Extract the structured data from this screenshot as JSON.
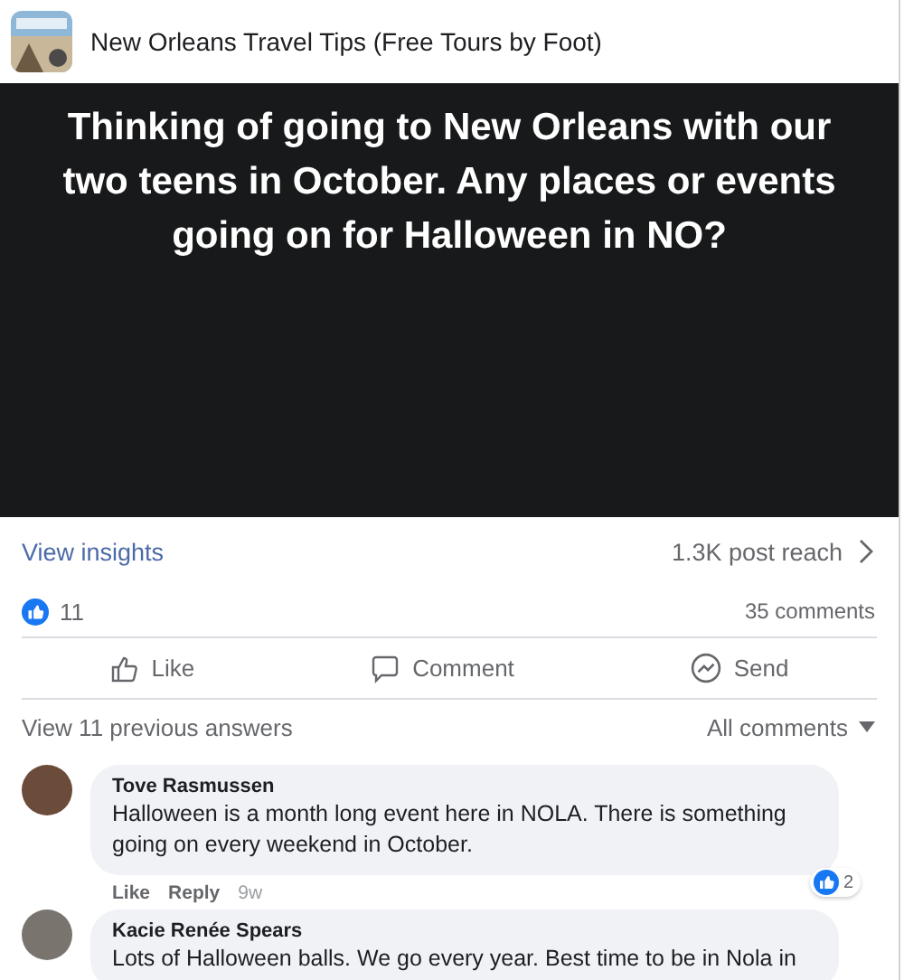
{
  "page": {
    "name": "New Orleans Travel Tips (Free Tours by Foot)"
  },
  "post": {
    "text": "Thinking of going to New Orleans with our two teens in October. Any places or events going on for Halloween in NO?"
  },
  "insights": {
    "link": "View insights",
    "reach": "1.3K post reach"
  },
  "stats": {
    "reactions": "11",
    "comments": "35 comments"
  },
  "actions": [
    {
      "kind": "like",
      "label": "Like"
    },
    {
      "kind": "comment",
      "label": "Comment"
    },
    {
      "kind": "send",
      "label": "Send"
    }
  ],
  "comments_bar": {
    "previous": "View 11 previous answers",
    "filter": "All comments"
  },
  "comments": [
    {
      "author": "Tove Rasmussen",
      "text": "Halloween is a month long event here in NOLA. There is something going on every weekend in October.",
      "like": "Like",
      "reply": "Reply",
      "time": "9w",
      "reactions": "2"
    },
    {
      "author": "Kacie Renée Spears",
      "text": "Lots of Halloween balls. We go every year. Best time to be in Nola in"
    }
  ]
}
